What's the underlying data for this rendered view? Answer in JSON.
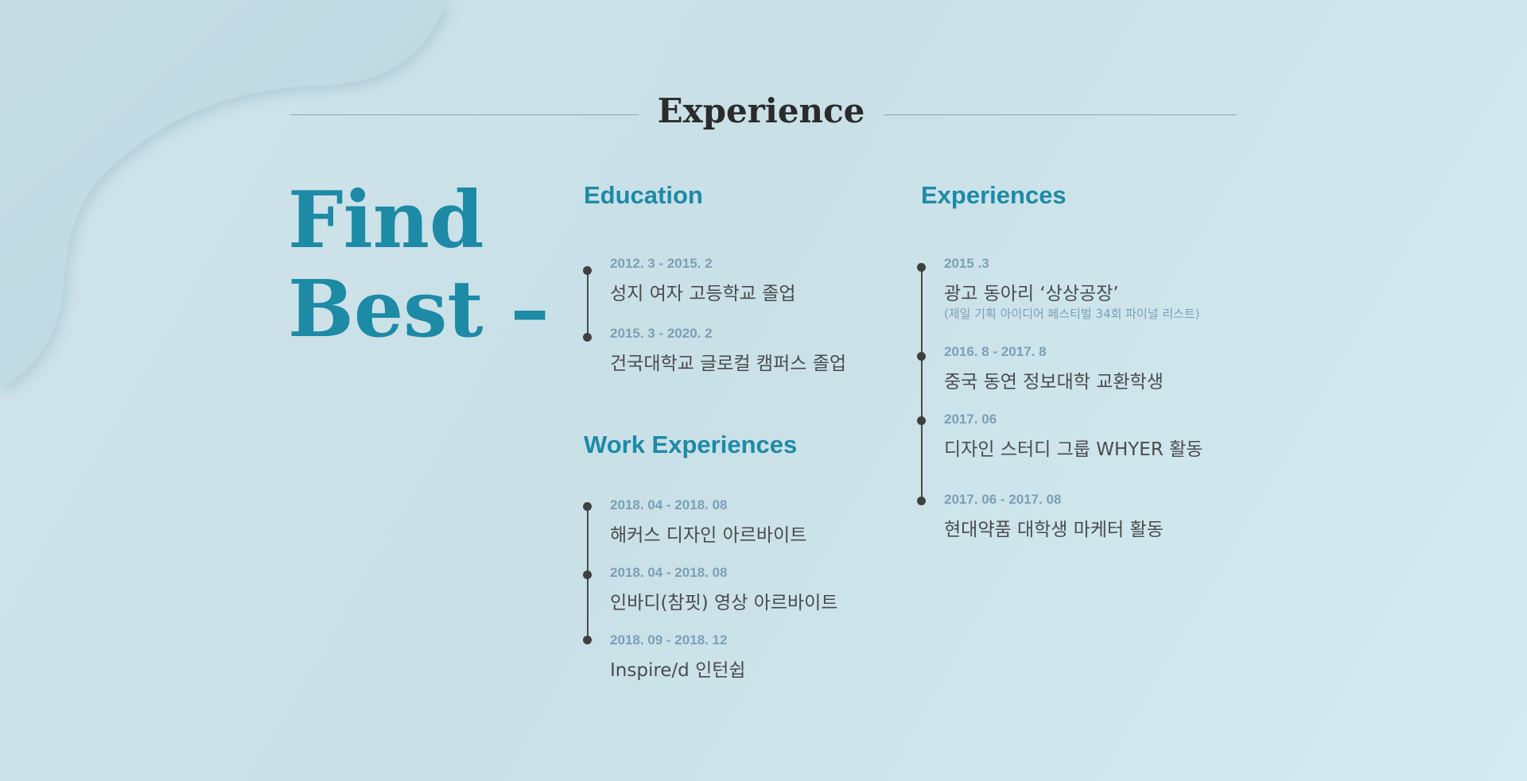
{
  "header": {
    "title": "Experience"
  },
  "hero": {
    "line1": "Find",
    "line2": "Best –"
  },
  "education": {
    "title": "Education",
    "items": [
      {
        "date": "2012. 3 - 2015. 2",
        "text": "성지 여자 고등학교 졸업"
      },
      {
        "date": "2015. 3 - 2020. 2",
        "text": "건국대학교 글로컬 캠퍼스 졸업"
      }
    ]
  },
  "work": {
    "title": "Work Experiences",
    "items": [
      {
        "date": "2018. 04 - 2018. 08",
        "text": "해커스 디자인 아르바이트"
      },
      {
        "date": "2018. 04 - 2018. 08",
        "text": "인바디(참핏) 영상 아르바이트"
      },
      {
        "date": "2018. 09 - 2018. 12",
        "text": "Inspire/d 인턴쉽"
      }
    ]
  },
  "experiences": {
    "title": "Experiences",
    "items": [
      {
        "date": "2015 .3",
        "text": "광고 동아리 ‘상상공장’",
        "note": "(제일 기획 아이디어 페스티벌 34회 파이널 리스트)"
      },
      {
        "date": "2016. 8 - 2017. 8",
        "text": "중국 동연 정보대학 교환학생"
      },
      {
        "date": "2017. 06",
        "text": "디자인 스터디 그룹 WHYER 활동"
      },
      {
        "date": "2017. 06 - 2017. 08",
        "text": "현대약품 대학생 마케터 활동"
      }
    ]
  },
  "colors": {
    "accent": "#1d8aa6",
    "date": "#7c9fb5",
    "text": "#4b4b4b",
    "title": "#2b2b2b",
    "background": "#cfe3ea"
  }
}
